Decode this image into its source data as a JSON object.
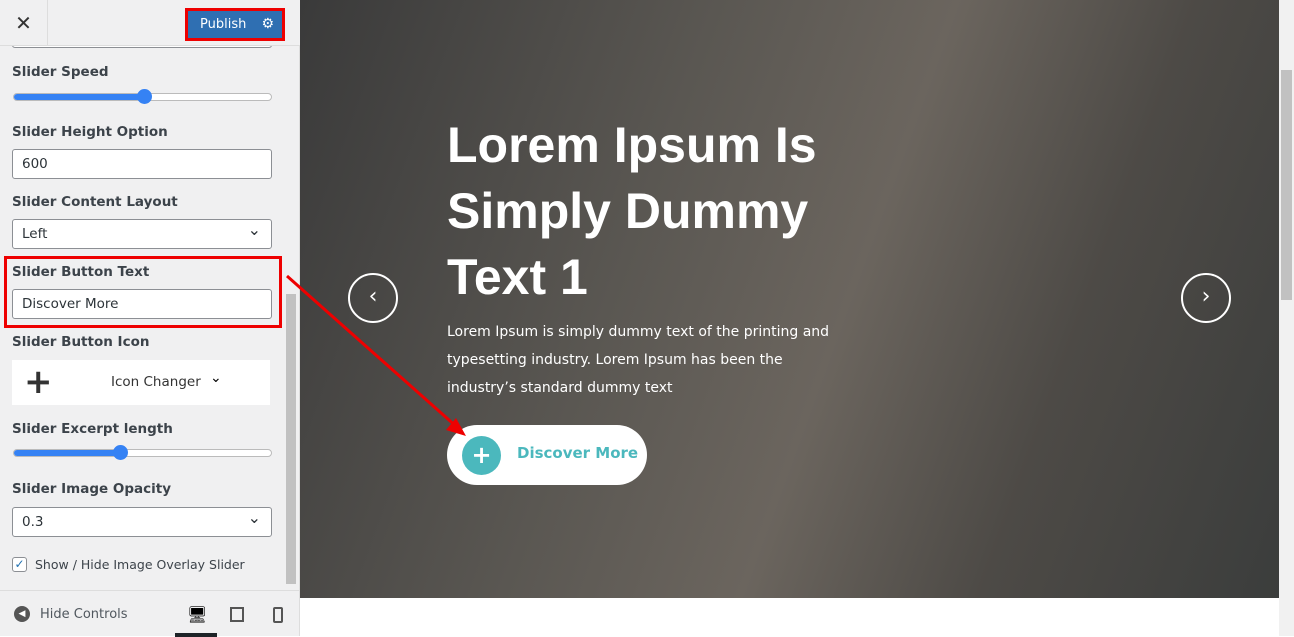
{
  "topbar": {
    "close_icon": "close-icon",
    "publish_label": "Publish",
    "gear_icon": "gear-icon"
  },
  "controls": {
    "slider_speed": {
      "label": "Slider Speed",
      "value_fraction": 0.5
    },
    "slider_height": {
      "label": "Slider Height Option",
      "value": "600"
    },
    "content_layout": {
      "label": "Slider Content Layout",
      "value": "Left"
    },
    "button_text": {
      "label": "Slider Button Text",
      "value": "Discover More"
    },
    "button_icon": {
      "label": "Slider Button Icon",
      "picker_label": "Icon Changer",
      "icon": "plus-icon"
    },
    "excerpt_length": {
      "label": "Slider Excerpt length",
      "value_fraction": 0.41
    },
    "image_opacity": {
      "label": "Slider Image Opacity",
      "value": "0.3"
    },
    "overlay": {
      "label": "Show / Hide Image Overlay Slider",
      "checked": true
    }
  },
  "footer": {
    "hide_controls": "Hide Controls",
    "devices": [
      "desktop",
      "tablet",
      "mobile"
    ]
  },
  "preview": {
    "title": "Lorem Ipsum Is Simply Dummy Text 1",
    "excerpt": "Lorem Ipsum is simply dummy text of the printing and typesetting industry. Lorem Ipsum has been the industry’s standard dummy text",
    "button": "Discover More",
    "prev": "‹",
    "next": "›"
  },
  "colors": {
    "accent": "#4bb8bd",
    "publish": "#2f6fb2",
    "highlight": "#ee0000"
  }
}
